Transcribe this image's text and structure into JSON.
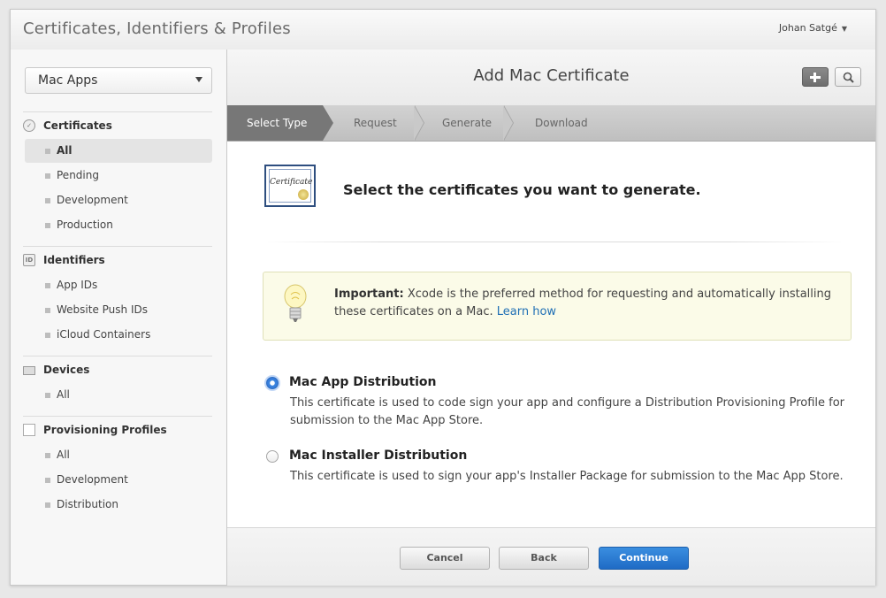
{
  "app": {
    "title": "Certificates, Identifiers & Profiles",
    "user_name": "Johan Satgé"
  },
  "sidebar": {
    "platform": "Mac Apps",
    "sections": [
      {
        "title": "Certificates",
        "icon": "certificate-icon",
        "items": [
          "All",
          "Pending",
          "Development",
          "Production"
        ]
      },
      {
        "title": "Identifiers",
        "icon": "id-badge-icon",
        "icon_text": "ID",
        "items": [
          "App IDs",
          "Website Push IDs",
          "iCloud Containers"
        ]
      },
      {
        "title": "Devices",
        "icon": "device-icon",
        "items": [
          "All"
        ]
      },
      {
        "title": "Provisioning Profiles",
        "icon": "document-icon",
        "items": [
          "All",
          "Development",
          "Distribution"
        ]
      }
    ],
    "active_item": "Certificates / All"
  },
  "main": {
    "title": "Add Mac Certificate",
    "steps": [
      "Select Type",
      "Request",
      "Generate",
      "Download"
    ],
    "active_step": "Select Type",
    "cert_icon_text": "Certificate",
    "heading": "Select the certificates you want to generate.",
    "notice": {
      "label": "Important:",
      "text": " Xcode is the preferred method for requesting and automatically installing these certificates on a Mac. ",
      "link": "Learn how"
    },
    "options": [
      {
        "title": "Mac App Distribution",
        "description": "This certificate is used to code sign your app and configure a Distribution Provisioning Profile for submission to the Mac App Store.",
        "selected": true
      },
      {
        "title": "Mac Installer Distribution",
        "description": "This certificate is used to sign your app's Installer Package for submission to the Mac App Store.",
        "selected": false
      }
    ]
  },
  "footer": {
    "cancel": "Cancel",
    "back": "Back",
    "continue": "Continue"
  },
  "colors": {
    "primary_button": "#2a75cf",
    "link": "#1f6fb5",
    "active_step": "#777777",
    "notice_bg": "#fbfbe8"
  }
}
